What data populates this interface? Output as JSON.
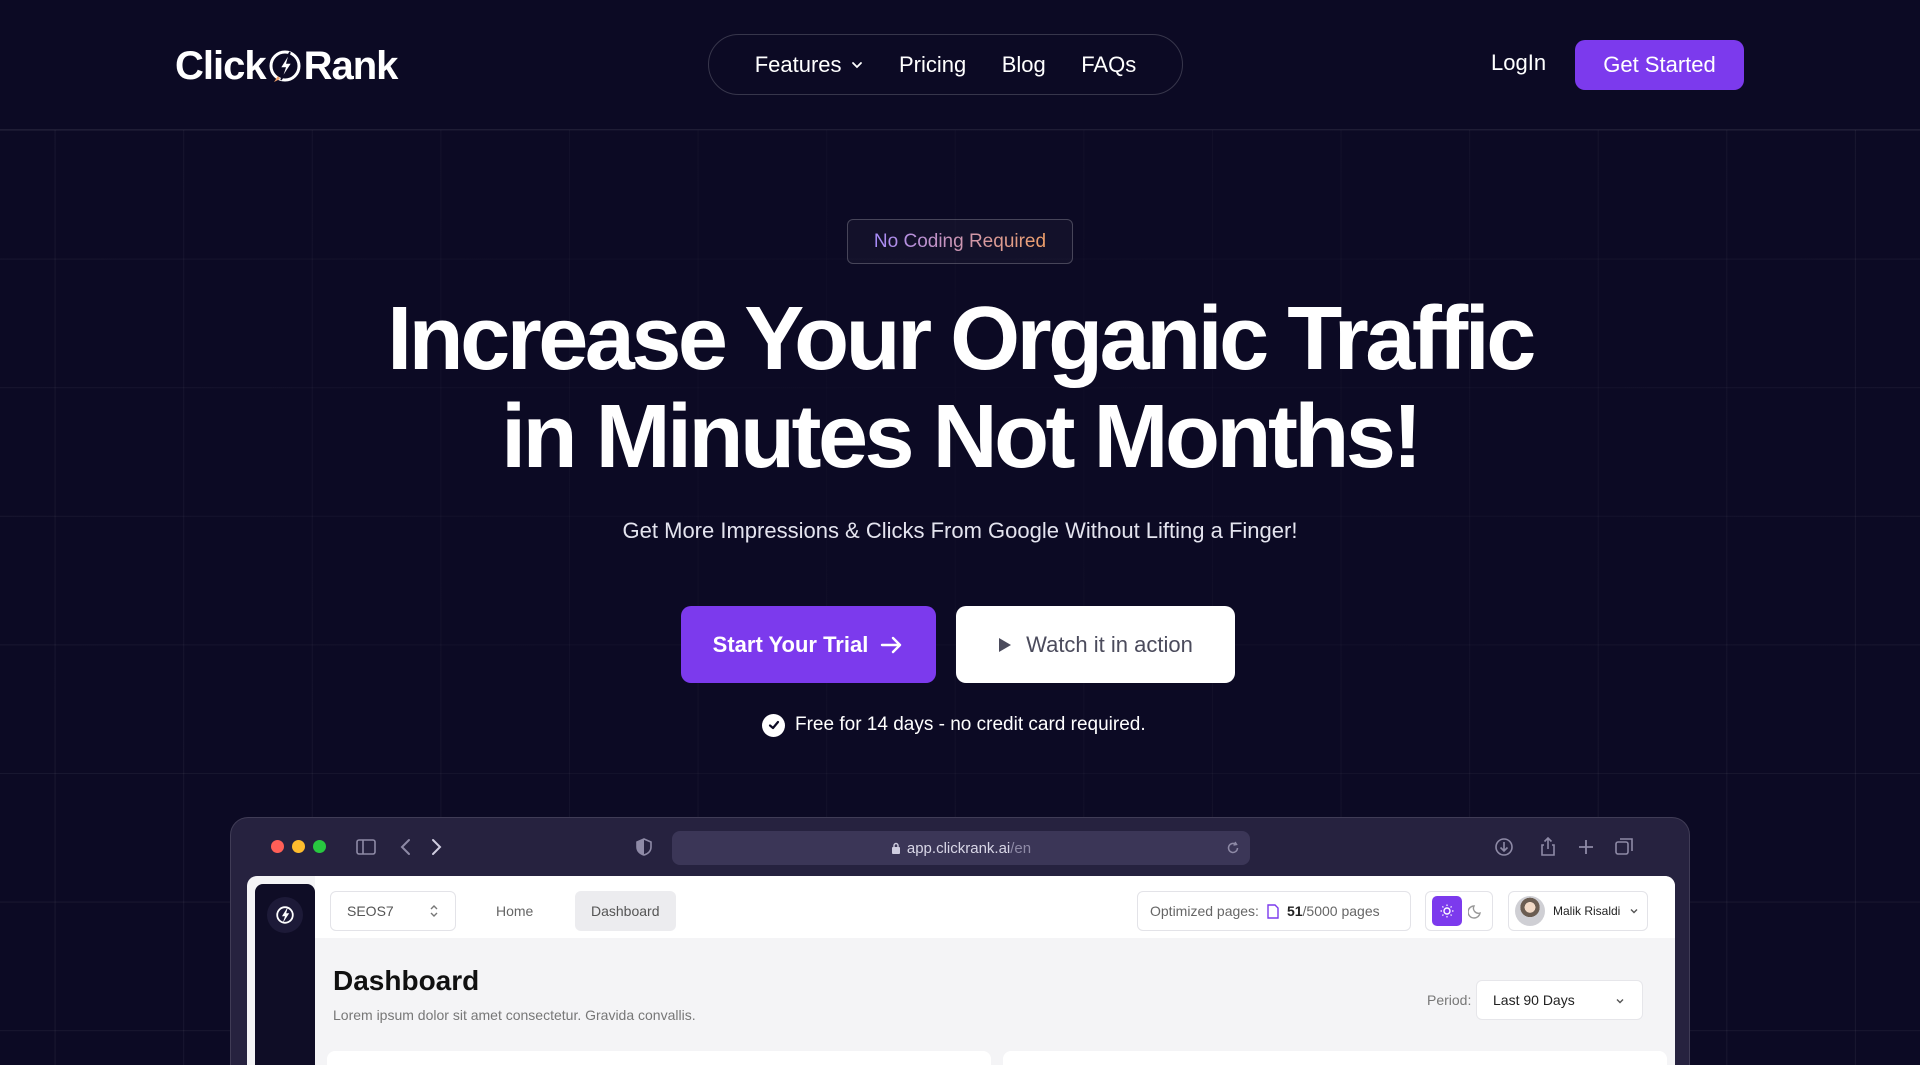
{
  "brand": {
    "name_left": "Click",
    "name_right": "Rank"
  },
  "nav": {
    "items": [
      {
        "label": "Features",
        "has_dropdown": true
      },
      {
        "label": "Pricing"
      },
      {
        "label": "Blog"
      },
      {
        "label": "FAQs"
      }
    ],
    "login_label": "LogIn",
    "get_started_label": "Get Started"
  },
  "hero": {
    "badge": "No Coding Required",
    "headline_line1": "Increase Your Organic Traffic",
    "headline_line2": "in Minutes Not Months!",
    "subheadline": "Get More Impressions & Clicks From Google Without Lifting a Finger!",
    "primary_cta": "Start Your Trial",
    "secondary_cta": "Watch it in action",
    "free_note": "Free for 14 days - no credit card required."
  },
  "mockup": {
    "url_host": "app.clickrank.ai",
    "url_path": "/en",
    "workspace": "SEOS7",
    "breadcrumbs": [
      "Home",
      "Dashboard"
    ],
    "optimized_label": "Optimized pages:",
    "optimized_count": "51",
    "optimized_total": "/5000 pages",
    "user_name": "Malik Risaldi",
    "page_title": "Dashboard",
    "page_subtitle": "Lorem ipsum dolor sit amet consectetur. Gravida convallis.",
    "period_label": "Period:",
    "period_value": "Last 90 Days"
  },
  "colors": {
    "background": "#0c0a24",
    "accent": "#7c3aed",
    "window_red": "#ff5f57",
    "window_yellow": "#febc2e",
    "window_green": "#28c840"
  }
}
